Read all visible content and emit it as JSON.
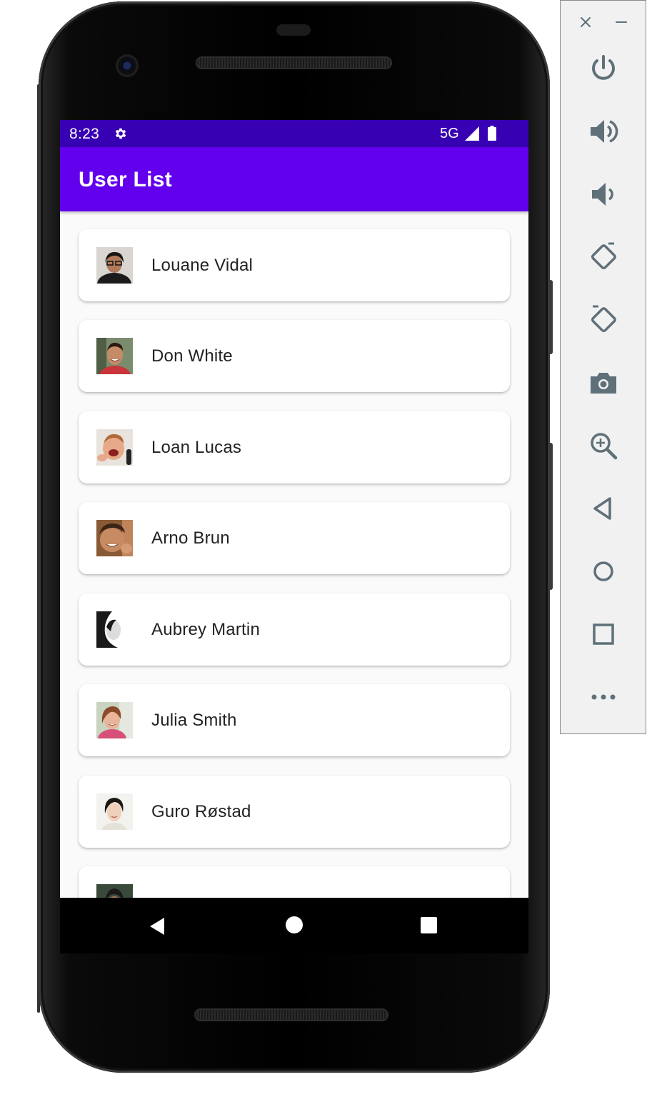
{
  "status_bar": {
    "time": "8:23",
    "network": "5G",
    "icons": [
      "settings-icon",
      "signal-icon",
      "battery-icon"
    ]
  },
  "app_bar": {
    "title": "User List"
  },
  "users": [
    {
      "name": "Louane Vidal",
      "avatar": "user-photo"
    },
    {
      "name": "Don White",
      "avatar": "user-photo"
    },
    {
      "name": "Loan Lucas",
      "avatar": "user-photo"
    },
    {
      "name": "Arno Brun",
      "avatar": "user-photo"
    },
    {
      "name": "Aubrey Martin",
      "avatar": "user-photo"
    },
    {
      "name": "Julia Smith",
      "avatar": "user-photo"
    },
    {
      "name": "Guro Røstad",
      "avatar": "user-photo"
    },
    {
      "name": "",
      "avatar": "user-photo"
    }
  ],
  "nav_bar": {
    "icons": [
      "back-triangle-icon",
      "home-circle-icon",
      "recents-square-icon"
    ]
  },
  "emulator_toolbar": {
    "icons": [
      "close-icon",
      "minimize-icon",
      "power-icon",
      "volume-up-icon",
      "volume-down-icon",
      "rotate-left-icon",
      "rotate-right-icon",
      "camera-icon",
      "zoom-icon",
      "back-icon",
      "home-icon",
      "overview-icon",
      "more-icon"
    ]
  },
  "colors": {
    "status_bar": "#3700b3",
    "app_bar": "#6200ee",
    "background": "#fafafa",
    "toolbar_icon": "#5f7079"
  }
}
